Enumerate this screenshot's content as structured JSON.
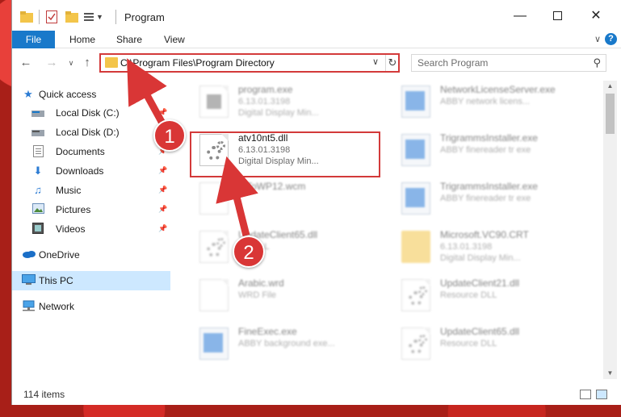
{
  "window": {
    "title": "Program"
  },
  "ribbon": {
    "tabs": [
      "File",
      "Home",
      "Share",
      "View"
    ]
  },
  "address": {
    "path": "C:\\Program Files\\Program Directory"
  },
  "search": {
    "placeholder": "Search Program"
  },
  "sidebar": {
    "items": [
      {
        "label": "Quick access",
        "icon": "star-icon",
        "pinned": false
      },
      {
        "label": "Local Disk (C:)",
        "icon": "drive-icon",
        "pinned": true
      },
      {
        "label": "Local Disk (D:)",
        "icon": "drive-icon",
        "pinned": true
      },
      {
        "label": "Documents",
        "icon": "documents-icon",
        "pinned": true
      },
      {
        "label": "Downloads",
        "icon": "download-icon",
        "pinned": true
      },
      {
        "label": "Music",
        "icon": "music-icon",
        "pinned": true
      },
      {
        "label": "Pictures",
        "icon": "pictures-icon",
        "pinned": true
      },
      {
        "label": "Videos",
        "icon": "videos-icon",
        "pinned": true
      },
      {
        "label": "OneDrive",
        "icon": "cloud-icon",
        "pinned": false
      },
      {
        "label": "This PC",
        "icon": "computer-icon",
        "pinned": false,
        "selected": true
      },
      {
        "label": "Network",
        "icon": "network-icon",
        "pinned": false
      }
    ]
  },
  "files": {
    "left": [
      {
        "name": "program.exe",
        "sub1": "6.13.01.3198",
        "sub2": "Digital Display Min...",
        "kind": "exe",
        "blurred": true
      },
      {
        "name": "atv10nt5.dll",
        "sub1": "6.13.01.3198",
        "sub2": "Digital Display Min...",
        "kind": "dll",
        "blurred": false
      },
      {
        "name": "...ToWP12.wcm",
        "sub1": "",
        "sub2": "",
        "kind": "doc",
        "blurred": true
      },
      {
        "name": "UpdateClient65.dll",
        "sub1": "...e DLL",
        "sub2": "",
        "kind": "dll",
        "blurred": true
      },
      {
        "name": "Arabic.wrd",
        "sub1": "WRD File",
        "sub2": "",
        "kind": "doc",
        "blurred": true
      },
      {
        "name": "FineExec.exe",
        "sub1": "ABBY background exe...",
        "sub2": "",
        "kind": "app",
        "blurred": true
      }
    ],
    "right": [
      {
        "name": "NetworkLicenseServer.exe",
        "sub1": "ABBY network licens...",
        "sub2": "",
        "kind": "app",
        "blurred": true
      },
      {
        "name": "TrigrammsInstaller.exe",
        "sub1": "ABBY finereader tr exe",
        "sub2": "",
        "kind": "app",
        "blurred": true
      },
      {
        "name": "TrigrammsInstaller.exe",
        "sub1": "ABBY finereader tr exe",
        "sub2": "",
        "kind": "app",
        "blurred": true
      },
      {
        "name": "Microsoft.VC90.CRT",
        "sub1": "6.13.01.3198",
        "sub2": "Digital Display Min...",
        "kind": "folder",
        "blurred": true
      },
      {
        "name": "UpdateClient21.dll",
        "sub1": "Resource DLL",
        "sub2": "",
        "kind": "dll",
        "blurred": true
      },
      {
        "name": "UpdateClient65.dll",
        "sub1": "Resource DLL",
        "sub2": "",
        "kind": "dll",
        "blurred": true
      }
    ]
  },
  "status": {
    "item_count": "114 items"
  },
  "annotations": {
    "step1": "1",
    "step2": "2"
  },
  "colors": {
    "accent": "#1979ca",
    "highlight": "#d33a3a",
    "selected": "#cde8ff"
  }
}
